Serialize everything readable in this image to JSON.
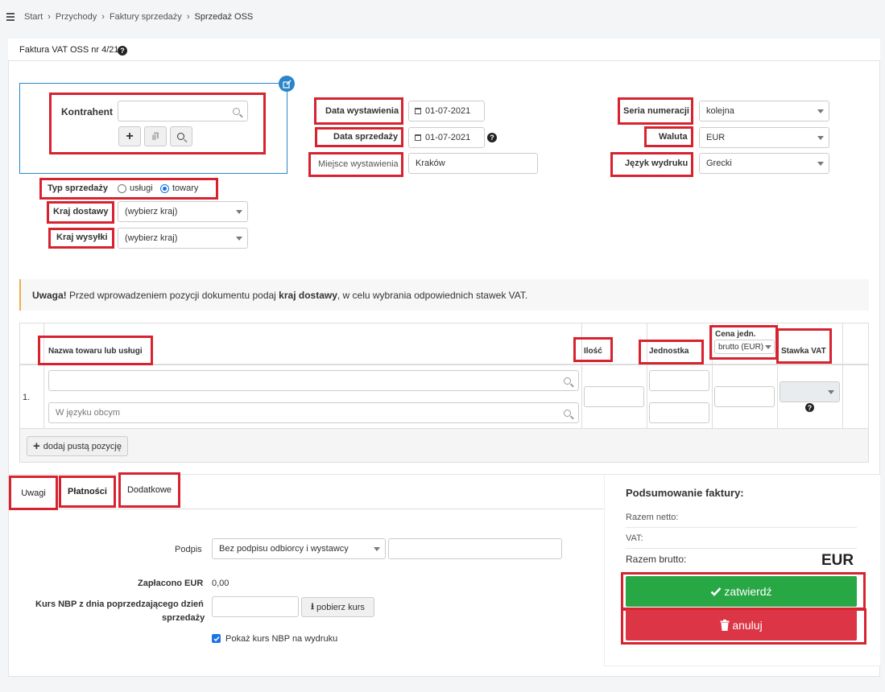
{
  "breadcrumb": {
    "items": [
      "Start",
      "Przychody",
      "Faktury sprzedaży",
      "Sprzedaż OSS"
    ]
  },
  "panel": {
    "title": "Faktura VAT OSS nr 4/21"
  },
  "contractor": {
    "label": "Kontrahent",
    "search_value": ""
  },
  "dates": {
    "issue_label": "Data wystawienia",
    "issue_value": "01-07-2021",
    "sale_label": "Data sprzedaży",
    "sale_value": "01-07-2021",
    "place_label": "Miejsce wystawienia",
    "place_value": "Kraków"
  },
  "settings": {
    "series_label": "Seria numeracji",
    "series_value": "kolejna",
    "currency_label": "Waluta",
    "currency_value": "EUR",
    "language_label": "Język wydruku",
    "language_value": "Grecki"
  },
  "sale_type": {
    "label": "Typ sprzedaży",
    "option_services": "usługi",
    "option_goods": "towary",
    "selected": "towary"
  },
  "countries": {
    "delivery_label": "Kraj dostawy",
    "delivery_value": "(wybierz kraj)",
    "shipping_label": "Kraj wysyłki",
    "shipping_value": "(wybierz kraj)"
  },
  "alert": {
    "strong": "Uwaga!",
    "text_before": " Przed wprowadzeniem pozycji dokumentu podaj ",
    "strong2": "kraj dostawy",
    "text_after": ", w celu wybrania odpowiednich stawek VAT."
  },
  "items_table": {
    "col_name": "Nazwa towaru lub usługi",
    "col_qty": "Ilość",
    "col_unit": "Jednostka",
    "col_price": "Cena jedn.",
    "price_type": "brutto (EUR)",
    "col_vat": "Stawka VAT",
    "row_number": "1.",
    "foreign_placeholder": "W języku obcym",
    "add_row_label": "dodaj pustą pozycję"
  },
  "tabs": [
    "Uwagi",
    "Płatności",
    "Dodatkowe"
  ],
  "signature": {
    "label": "Podpis",
    "value": "Bez podpisu odbiorcy i wystawcy"
  },
  "paid": {
    "label": "Zapłacono EUR",
    "value": "0,00"
  },
  "nbp": {
    "label_line1": "Kurs NBP z dnia poprzedzającego dzień",
    "label_line2": "sprzedaży",
    "fetch_button": "pobierz kurs",
    "show_on_print": "Pokaż kurs NBP na wydruku"
  },
  "summary": {
    "title": "Podsumowanie faktury:",
    "net_label": "Razem netto:",
    "vat_label": "VAT:",
    "gross_label": "Razem brutto:",
    "currency": "EUR",
    "confirm_button": "zatwierdź",
    "cancel_button": "anuluj"
  },
  "colors": {
    "highlight": "#d7232f",
    "confirm": "#28a745",
    "cancel": "#dc3545",
    "radio_accent": "#1a73e8",
    "edit_badge": "#2a86c8"
  }
}
